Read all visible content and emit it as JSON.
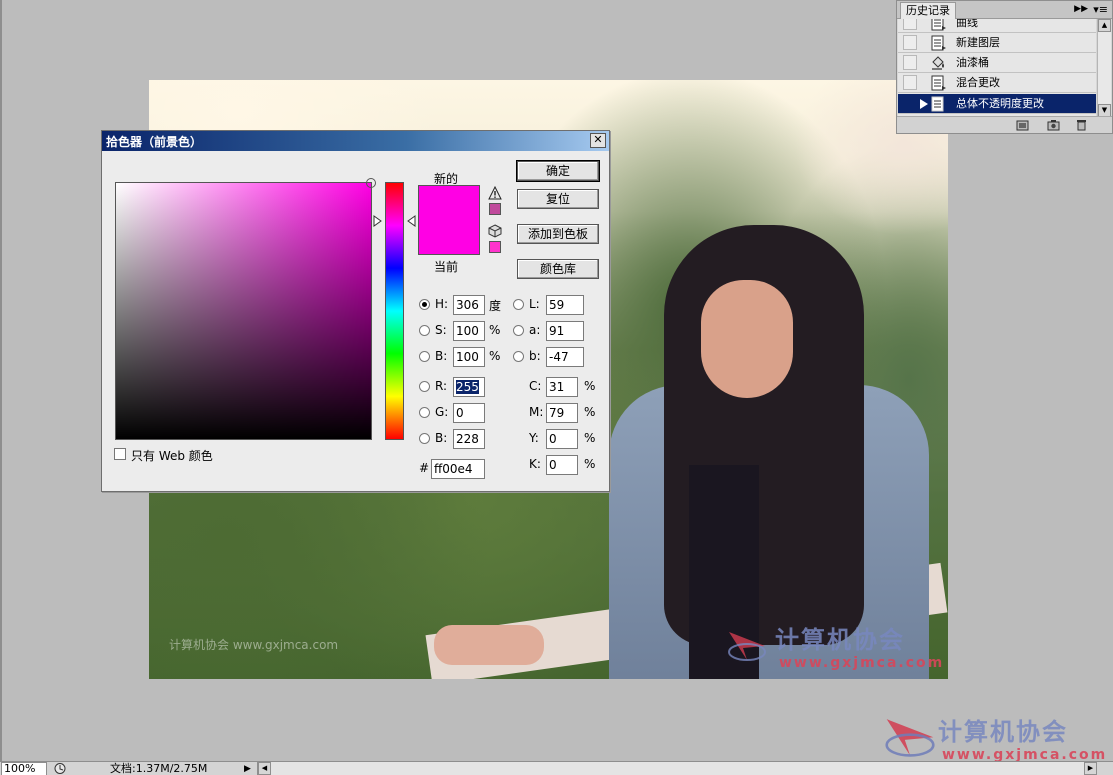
{
  "colors": {
    "foreground": "#ff00e4",
    "gamut_warning": "#c04a9c",
    "web_safe": "#ff33cc",
    "selection": "#0a246a"
  },
  "history_panel": {
    "tab_label": "历史记录",
    "collapse_icon": "double-arrow-right-icon",
    "menu_icon": "panel-menu-icon",
    "items": [
      {
        "label": "曲线",
        "icon": "history-state-icon"
      },
      {
        "label": "新建图层",
        "icon": "history-state-icon"
      },
      {
        "label": "油漆桶",
        "icon": "paint-bucket-icon"
      },
      {
        "label": "混合更改",
        "icon": "history-state-icon"
      },
      {
        "label": "总体不透明度更改",
        "icon": "history-state-icon",
        "selected": true
      }
    ],
    "footer_icons": [
      "new-document-icon",
      "snapshot-camera-icon",
      "trash-icon"
    ]
  },
  "color_picker": {
    "title": "拾色器（前景色）",
    "label_new": "新的",
    "label_current": "当前",
    "buttons": {
      "ok": "确定",
      "reset": "复位",
      "add_to_swatches": "添加到色板",
      "color_libraries": "颜色库"
    },
    "hsb": {
      "h_label": "H:",
      "h_value": "306",
      "h_unit": "度",
      "s_label": "S:",
      "s_value": "100",
      "s_unit": "%",
      "b_label": "B:",
      "b_value": "100",
      "b_unit": "%"
    },
    "lab": {
      "l_label": "L:",
      "l_value": "59",
      "a_label": "a:",
      "a_value": "91",
      "b_label": "b:",
      "b_value": "-47"
    },
    "rgb": {
      "r_label": "R:",
      "r_value": "255",
      "g_label": "G:",
      "g_value": "0",
      "b_label": "B:",
      "b_value": "228"
    },
    "cmyk": {
      "c_label": "C:",
      "c_value": "31",
      "c_unit": "%",
      "m_label": "M:",
      "m_value": "79",
      "m_unit": "%",
      "y_label": "Y:",
      "y_value": "0",
      "y_unit": "%",
      "k_label": "K:",
      "k_value": "0",
      "k_unit": "%"
    },
    "hex_label": "#",
    "hex_value": "ff00e4",
    "web_only_label": "只有 Web 颜色",
    "selected_mode": "H"
  },
  "watermarks": {
    "photo_small": "计算机协会 www.gxjmca.com",
    "photo_title": "计算机协会",
    "photo_url": "www.gxjmca.com",
    "corner_title": "计算机协会",
    "corner_url": "www.gxjmca.com"
  },
  "status_bar": {
    "zoom": "100%",
    "doc_info": "文档:1.37M/2.75M"
  }
}
